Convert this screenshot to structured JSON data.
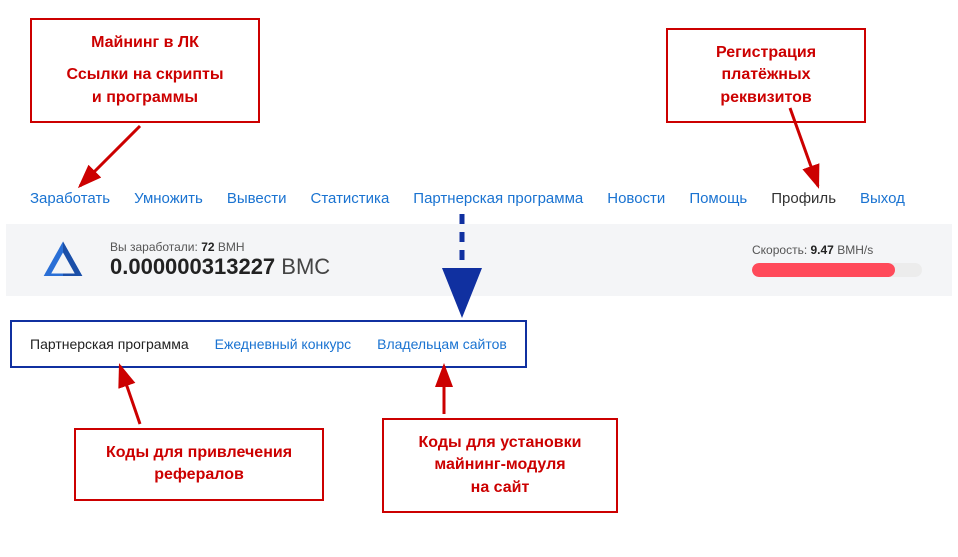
{
  "annotations": {
    "top_left_line1": "Майнинг в ЛК",
    "top_left_line2": "Ссылки на скрипты",
    "top_left_line3": "и программы",
    "top_right_line1": "Регистрация",
    "top_right_line2": "платёжных",
    "top_right_line3": "реквизитов",
    "bottom_left_line1": "Коды для привлечения",
    "bottom_left_line2": "рефералов",
    "bottom_right_line1": "Коды для установки",
    "bottom_right_line2": "майнинг-модуля",
    "bottom_right_line3": "на сайт"
  },
  "nav": {
    "earn": "Заработать",
    "multiply": "Умножить",
    "withdraw": "Вывести",
    "stats": "Статистика",
    "affiliate": "Партнерская программа",
    "news": "Новости",
    "help": "Помощь",
    "profile": "Профиль",
    "logout": "Выход"
  },
  "earn": {
    "small_prefix": "Вы заработали: ",
    "small_value": "72",
    "small_unit": " BMH",
    "big_value": "0.000000313227",
    "big_unit": " BMC"
  },
  "speed": {
    "label_prefix": "Скорость: ",
    "value": "9.47",
    "unit": " BMH/s"
  },
  "subtabs": {
    "affiliate": "Партнерская программа",
    "daily": "Ежедневный конкурс",
    "owners": "Владельцам сайтов"
  }
}
